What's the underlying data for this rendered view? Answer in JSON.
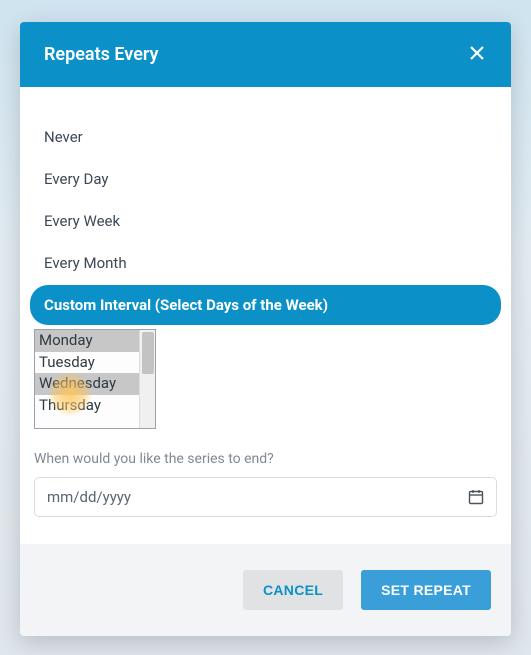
{
  "modal": {
    "title": "Repeats Every",
    "options": [
      {
        "label": "Never",
        "selected": false
      },
      {
        "label": "Every Day",
        "selected": false
      },
      {
        "label": "Every Week",
        "selected": false
      },
      {
        "label": "Every Month",
        "selected": false
      },
      {
        "label": "Custom Interval (Select Days of the Week)",
        "selected": true
      }
    ],
    "days": [
      {
        "label": "Monday",
        "selected": true
      },
      {
        "label": "Tuesday",
        "selected": false
      },
      {
        "label": "Wednesday",
        "selected": true
      },
      {
        "label": "Thursday",
        "selected": false
      }
    ],
    "end_label": "When would you like the series to end?",
    "date_placeholder": "mm/dd/yyyy"
  },
  "footer": {
    "cancel": "CANCEL",
    "set_repeat": "SET REPEAT"
  }
}
